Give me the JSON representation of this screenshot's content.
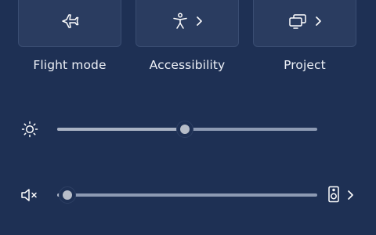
{
  "quick_settings": {
    "tiles": [
      {
        "label": "Flight mode",
        "icon": "airplane-icon",
        "has_chevron": false
      },
      {
        "label": "Accessibility",
        "icon": "accessibility-icon",
        "has_chevron": true
      },
      {
        "label": "Project",
        "icon": "project-display-icon",
        "has_chevron": true
      }
    ]
  },
  "brightness": {
    "icon": "sun-icon",
    "value_fraction": 0.49
  },
  "volume": {
    "icon": "speaker-muted-icon",
    "value_fraction": 0.04,
    "output_icon": "speaker-device-icon"
  },
  "colors": {
    "background": "#1e3054",
    "tile": "#2a3c60",
    "track": "#8d9ab3",
    "text": "#eef1f7"
  }
}
